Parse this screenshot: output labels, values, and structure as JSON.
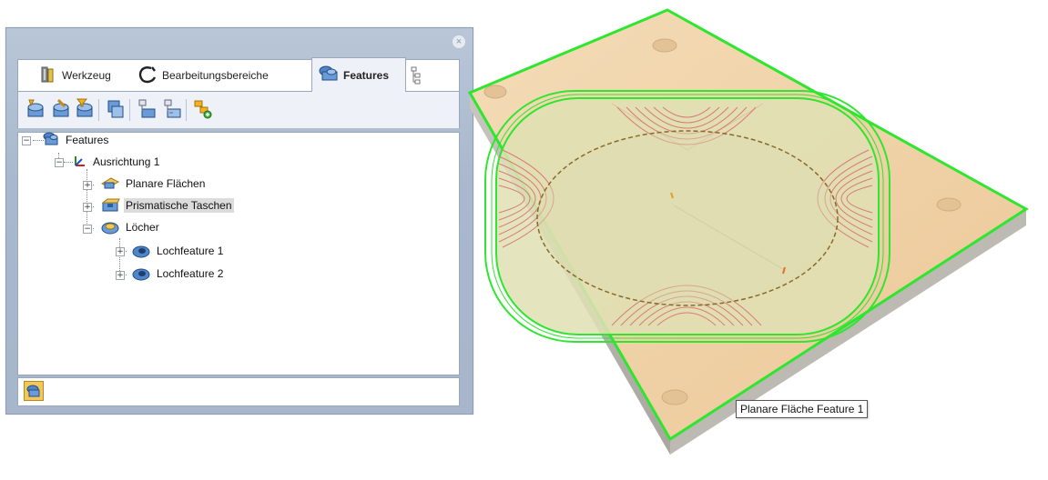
{
  "panel": {
    "close_glyph": "×",
    "tabs": [
      {
        "label": "Werkzeug",
        "icon": "tool-holder-icon",
        "active": false
      },
      {
        "label": "Bearbeitungsbereiche",
        "icon": "boundary-curve-icon",
        "active": false
      },
      {
        "label": "Features",
        "icon": "features-icon",
        "active": true
      }
    ],
    "toolbar": [
      {
        "icon": "add-feature-icon"
      },
      {
        "icon": "edit-feature-icon"
      },
      {
        "icon": "filter-feature-icon"
      },
      {
        "icon": "copy-feature-icon"
      },
      {
        "icon": "group-feature-icon"
      },
      {
        "icon": "ungroup-feature-icon"
      },
      {
        "icon": "add-subfeature-icon"
      }
    ],
    "tree": {
      "root": "Features",
      "alignment": "Ausrichtung 1",
      "groups": [
        {
          "label": "Planare Flächen",
          "expanded": false,
          "selected": false
        },
        {
          "label": "Prismatische Taschen",
          "expanded": false,
          "selected": true
        },
        {
          "label": "Löcher",
          "expanded": true,
          "selected": false,
          "children": [
            "Lochfeature 1",
            "Lochfeature 2"
          ]
        }
      ]
    },
    "status_icon": "features-status-icon"
  },
  "viewport": {
    "tooltip": "Planare Fläche Feature 1",
    "colors": {
      "plate_top": "#f0d2a8",
      "plate_side": "#b7b4ae",
      "highlight": "#2ee62e",
      "pocket": "#d9dcae",
      "toolpath": "#d87a7a"
    }
  }
}
